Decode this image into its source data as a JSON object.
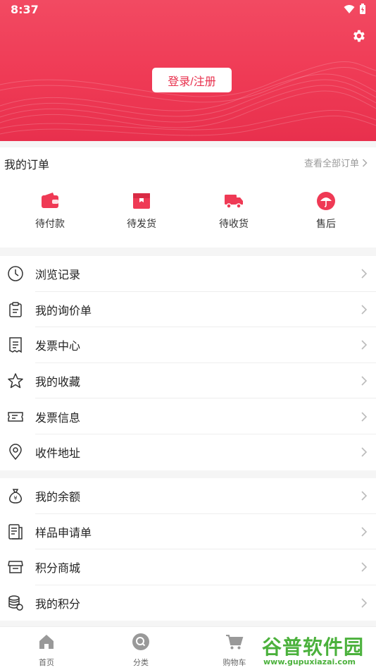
{
  "status": {
    "time": "8:37"
  },
  "header": {
    "login_label": "登录/注册"
  },
  "orders": {
    "title": "我的订单",
    "view_all": "查看全部订单",
    "items": [
      {
        "label": "待付款",
        "icon": "wallet-icon"
      },
      {
        "label": "待发货",
        "icon": "package-icon"
      },
      {
        "label": "待收货",
        "icon": "truck-icon"
      },
      {
        "label": "售后",
        "icon": "umbrella-icon"
      }
    ]
  },
  "menu_group1": [
    {
      "label": "浏览记录",
      "icon": "clock-icon"
    },
    {
      "label": "我的询价单",
      "icon": "clipboard-icon"
    },
    {
      "label": "发票中心",
      "icon": "receipt-icon"
    },
    {
      "label": "我的收藏",
      "icon": "star-icon"
    },
    {
      "label": "发票信息",
      "icon": "ticket-icon"
    },
    {
      "label": "收件地址",
      "icon": "location-pin-icon"
    }
  ],
  "menu_group2": [
    {
      "label": "我的余额",
      "icon": "money-bag-icon"
    },
    {
      "label": "样品申请单",
      "icon": "document-icon"
    },
    {
      "label": "积分商城",
      "icon": "store-icon"
    },
    {
      "label": "我的积分",
      "icon": "coins-icon"
    }
  ],
  "tabbar": [
    {
      "label": "首页",
      "icon": "home-icon"
    },
    {
      "label": "分类",
      "icon": "category-icon"
    },
    {
      "label": "购物车",
      "icon": "cart-icon"
    }
  ],
  "watermark": {
    "big": "谷普软件园",
    "small": "www.gupuxiazai.com"
  },
  "colors": {
    "accent": "#ef3a55",
    "watermark": "#4bb13c"
  }
}
